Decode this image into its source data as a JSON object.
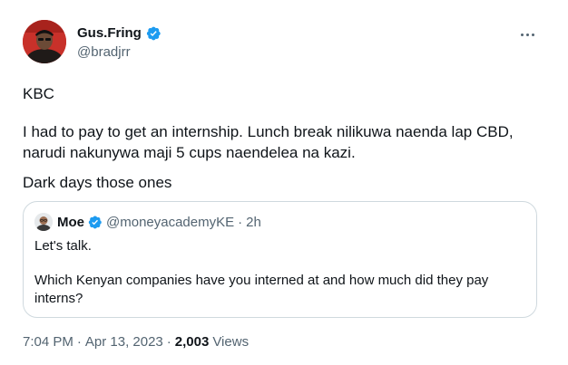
{
  "author": {
    "display_name": "Gus.Fring",
    "handle": "@bradjrr",
    "avatar_icon": "profile-photo",
    "verified_icon": "verified-badge-icon"
  },
  "tweet": {
    "paragraphs": [
      "KBC",
      "I had to pay to get an internship. Lunch break nilikuwa naenda lap CBD, narudi nakunywa maji 5 cups naendelea na kazi.",
      "Dark days those ones"
    ]
  },
  "quoted_tweet": {
    "display_name": "Moe",
    "handle": "@moneyacademyKE",
    "separator": "·",
    "time": "2h",
    "paragraphs": [
      "Let's talk.",
      "Which Kenyan companies have you interned at and how much did they pay interns?"
    ]
  },
  "meta": {
    "time": "7:04 PM",
    "separator": "·",
    "date": "Apr 13, 2023",
    "views_count": "2,003",
    "views_label": "Views"
  },
  "colors": {
    "verified_blue": "#1d9bf0",
    "secondary_text": "#536471",
    "primary_text": "#0f1419",
    "border": "#cfd9de"
  }
}
